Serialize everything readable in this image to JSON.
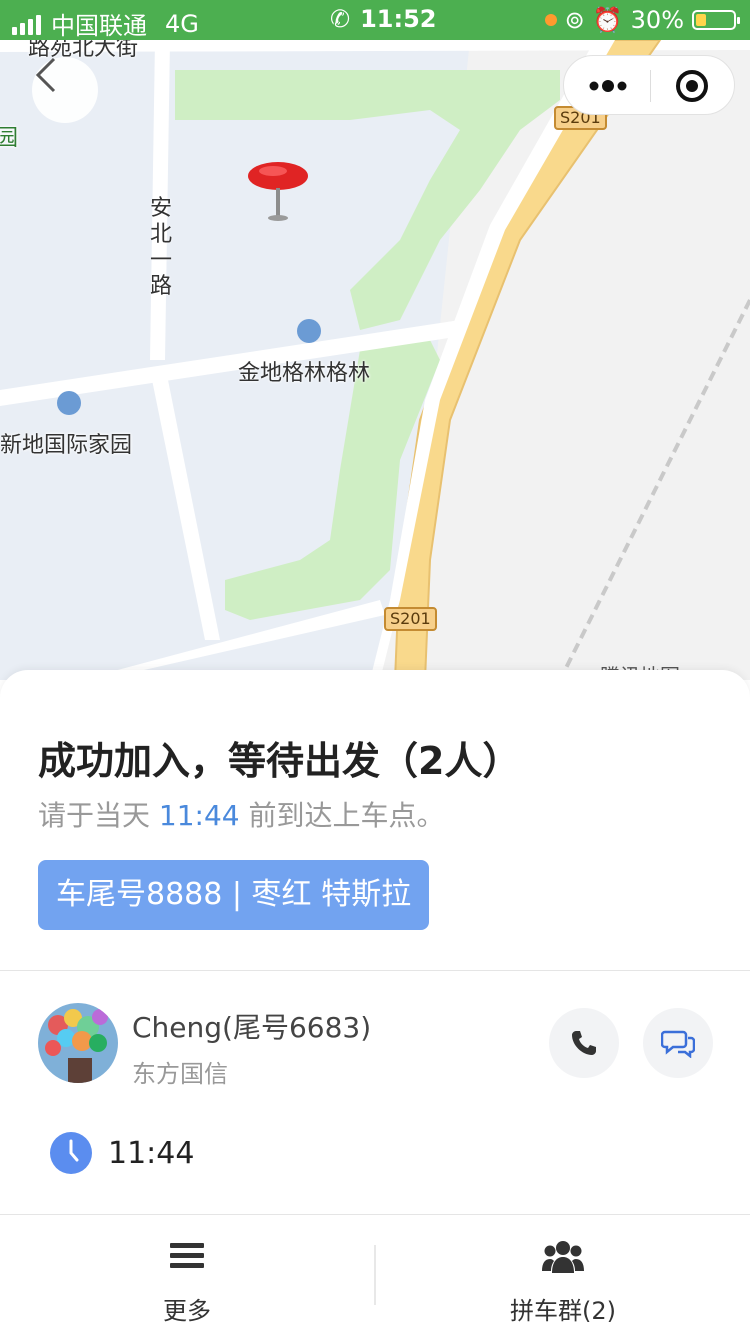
{
  "status_bar": {
    "carrier": "中国联通",
    "network": "4G",
    "time": "11:52",
    "battery": "30%"
  },
  "map": {
    "labels": {
      "top_street": "路苑北大街",
      "road_vertical": "安北一路",
      "poi_1": "金地格林格林",
      "poi_2": "新地国际家园",
      "highway_1": "S201",
      "highway_2": "S201",
      "left_edge": "园",
      "logo": "腾讯地图"
    }
  },
  "card": {
    "title": "成功加入，等待出发（2人）",
    "subtitle_prefix": "请于当天",
    "subtitle_time": "11:44",
    "subtitle_suffix": "前到达上车点。",
    "car_info": "车尾号8888 | 枣红 特斯拉",
    "driver": {
      "name": "Cheng(尾号6683)",
      "company": "东方国信"
    },
    "departure_time": "11:44"
  },
  "bottom_bar": {
    "more_label": "更多",
    "group_label": "拼车群(2)"
  },
  "colors": {
    "status_bar": "#4caf50",
    "accent_blue": "#4a89dc",
    "car_badge": "#72a3f0"
  },
  "icons": [
    "back-icon",
    "more-dots-icon",
    "target-icon",
    "map-pin-icon",
    "phone-icon",
    "chat-icon",
    "clock-icon",
    "menu-icon",
    "group-icon"
  ]
}
